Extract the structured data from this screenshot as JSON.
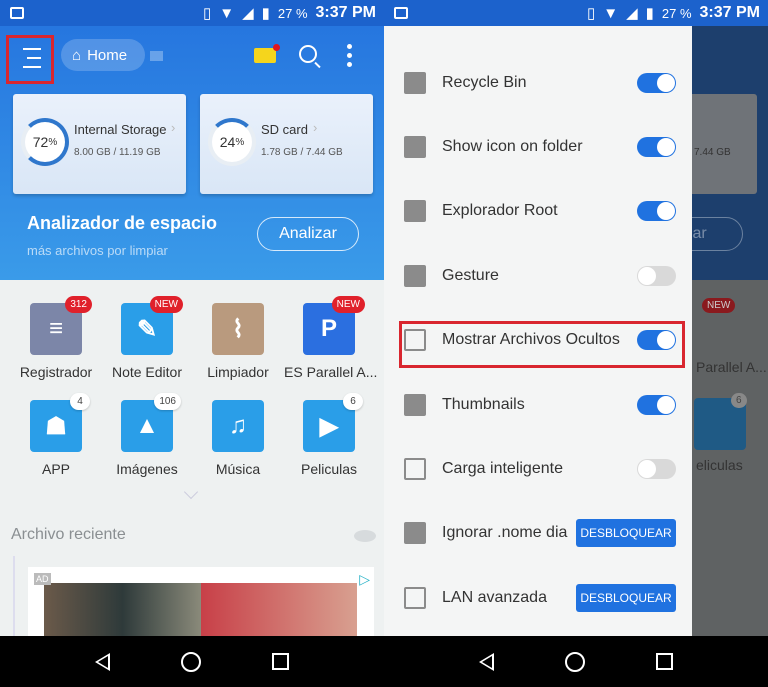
{
  "status_bar": {
    "battery": "27 %",
    "time": "3:37 PM"
  },
  "left": {
    "header": {
      "home_label": "Home"
    },
    "storage": [
      {
        "name": "Internal Storage",
        "percent": "72",
        "unit": "%",
        "size": "8.00 GB / 11.19 GB",
        "used_fraction": 0.72
      },
      {
        "name": "SD card",
        "percent": "24",
        "unit": "%",
        "size": "1.78 GB / 7.44 GB",
        "used_fraction": 0.24
      }
    ],
    "analyzer": {
      "title": "Analizador de espacio",
      "subtitle": "más archivos por limpiar",
      "button": "Analizar"
    },
    "apps": [
      {
        "label": "Registrador",
        "badge": "312",
        "color": "#7c86a8"
      },
      {
        "label": "Note Editor",
        "badge": "NEW",
        "color": "#2a9ee8"
      },
      {
        "label": "Limpiador",
        "badge": "",
        "color": "#b99a7e"
      },
      {
        "label": "ES Parallel A...",
        "badge": "NEW",
        "color": "#2b6fe0"
      },
      {
        "label": "APP",
        "badge": "4",
        "color": "#2a9ee8"
      },
      {
        "label": "Imágenes",
        "badge": "106",
        "color": "#2a9ee8"
      },
      {
        "label": "Música",
        "badge": "",
        "color": "#2a9ee8"
      },
      {
        "label": "Peliculas",
        "badge": "6",
        "color": "#2a9ee8"
      }
    ],
    "recent_title": "Archivo reciente",
    "ad_tag": "AD"
  },
  "right": {
    "background": {
      "sd_size": "7.44 GB",
      "button": "lizar",
      "app_label_1": "Parallel A...",
      "app_label_2": "eliculas",
      "badge_new": "NEW",
      "badge_6": "6"
    },
    "settings": [
      {
        "label": "Recycle Bin",
        "type": "toggle",
        "on": true
      },
      {
        "label": "Show icon on folder",
        "type": "toggle",
        "on": true
      },
      {
        "label": "Explorador Root",
        "type": "toggle",
        "on": true
      },
      {
        "label": "Gesture",
        "type": "toggle",
        "on": false
      },
      {
        "label": "Mostrar Archivos Ocultos",
        "type": "toggle",
        "on": true
      },
      {
        "label": "Thumbnails",
        "type": "toggle",
        "on": true
      },
      {
        "label": "Carga inteligente",
        "type": "toggle",
        "on": false
      },
      {
        "label": "Ignorar .nome dia",
        "type": "button",
        "button": "DESBLOQUEAR"
      },
      {
        "label": "LAN avanzada",
        "type": "button",
        "button": "DESBLOQUEAR"
      }
    ]
  },
  "colors": {
    "accent": "#2072e0",
    "highlight": "#d9262f"
  }
}
